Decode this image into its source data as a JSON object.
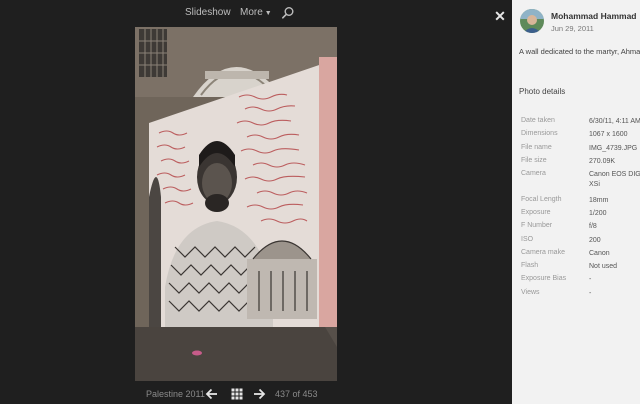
{
  "toolbar": {
    "slideshow_label": "Slideshow",
    "more_label": "More",
    "close_glyph": "✕"
  },
  "photo": {
    "subject": "wall mural portrait"
  },
  "footer": {
    "album": "Palestine 2011",
    "counter": "437 of 453"
  },
  "sidebar": {
    "author": "Mohammad Hammad",
    "date": "Jun 29, 2011",
    "caption": "A wall dedicated to the martyr, Ahmad",
    "details_title": "Photo details",
    "details": [
      {
        "label": "Date taken",
        "value": "6/30/11, 4:11 AM"
      },
      {
        "label": "Dimensions",
        "value": "1067 x 1600"
      },
      {
        "label": "File name",
        "value": "IMG_4739.JPG"
      },
      {
        "label": "File size",
        "value": "270.09K"
      },
      {
        "label": "Camera",
        "value": "Canon EOS DIGITAL REBEL",
        "value2": "XSi"
      },
      {
        "label": "Focal Length",
        "value": "18mm"
      },
      {
        "label": "Exposure",
        "value": "1/200"
      },
      {
        "label": "F Number",
        "value": "f/8"
      },
      {
        "label": "ISO",
        "value": "200"
      },
      {
        "label": "Camera make",
        "value": "Canon"
      },
      {
        "label": "Flash",
        "value": "Not used"
      },
      {
        "label": "Exposure Bias",
        "value": "-"
      },
      {
        "label": "Views",
        "value": "-"
      }
    ]
  },
  "colors": {
    "viewer_background": "#1f1f1f",
    "sidebar_background": "#f2f2f2"
  }
}
